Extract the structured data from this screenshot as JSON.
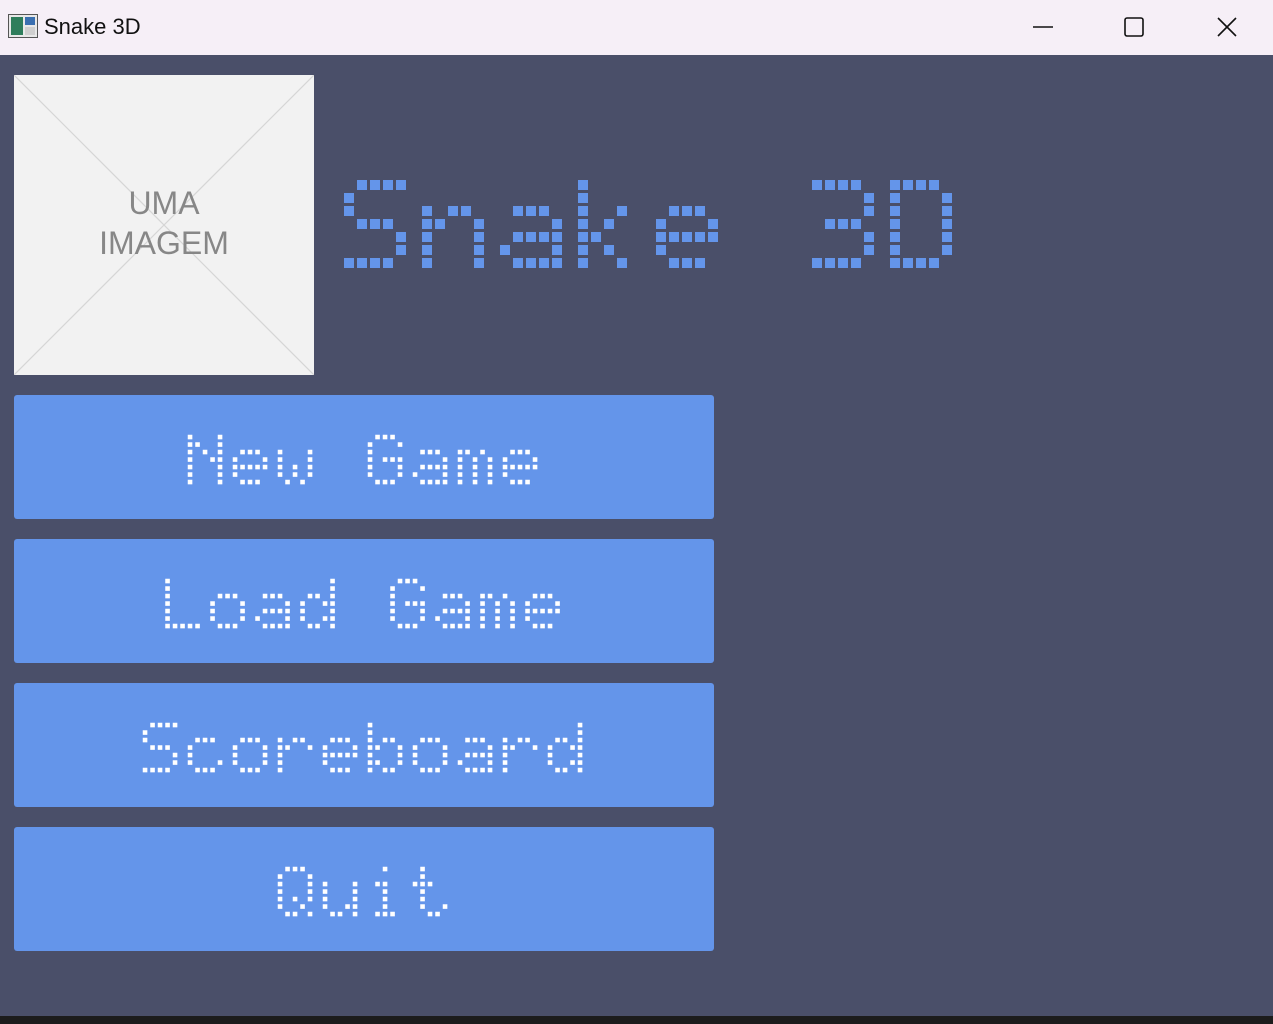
{
  "window": {
    "title": "Snake 3D",
    "icon": "window-app-icon",
    "controls": [
      "minimize-icon",
      "maximize-icon",
      "close-icon"
    ]
  },
  "header": {
    "image_placeholder_text": "UMA\nIMAGEM",
    "game_title": "Snake 3D"
  },
  "menu": {
    "buttons": [
      {
        "label": "New Game"
      },
      {
        "label": "Load Game"
      },
      {
        "label": "Scoreboard"
      },
      {
        "label": "Quit"
      }
    ]
  },
  "colors": {
    "background": "#4a4f69",
    "titlebar": "#f6eff7",
    "title_dots": "#6495ea",
    "button": "#6495ea",
    "button_text_dots": "#ffffff",
    "placeholder_bg": "#f2f2f2",
    "placeholder_text": "#878787"
  }
}
